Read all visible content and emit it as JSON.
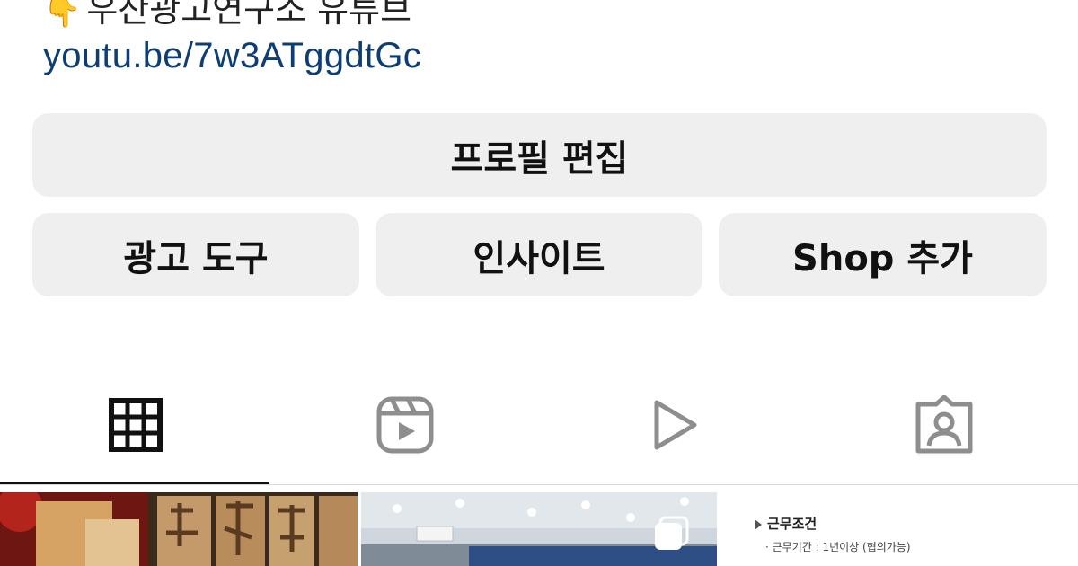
{
  "profile": {
    "bio_line": "우산광고연구소 유튜브",
    "link": "youtu.be/7w3ATggdtGc"
  },
  "buttons": {
    "edit_profile": "프로필 편집",
    "ad_tools": "광고 도구",
    "insights": "인사이트",
    "add_shop": "Shop 추가"
  },
  "tabs": [
    {
      "icon": "grid-icon",
      "active": true
    },
    {
      "icon": "reels-icon",
      "active": false
    },
    {
      "icon": "video-play-icon",
      "active": false
    },
    {
      "icon": "tagged-person-icon",
      "active": false
    }
  ],
  "posts": [
    {
      "type": "photo"
    },
    {
      "type": "photo",
      "multi": true
    },
    {
      "type": "document",
      "heading": "근무조건",
      "line": "· 근무기간 : 1년이상 (협의가능)"
    }
  ],
  "colors": {
    "link": "#0c3d75",
    "button_bg": "#efefef",
    "active_tab": "#111111",
    "inactive_tab": "#8e8e8e"
  }
}
